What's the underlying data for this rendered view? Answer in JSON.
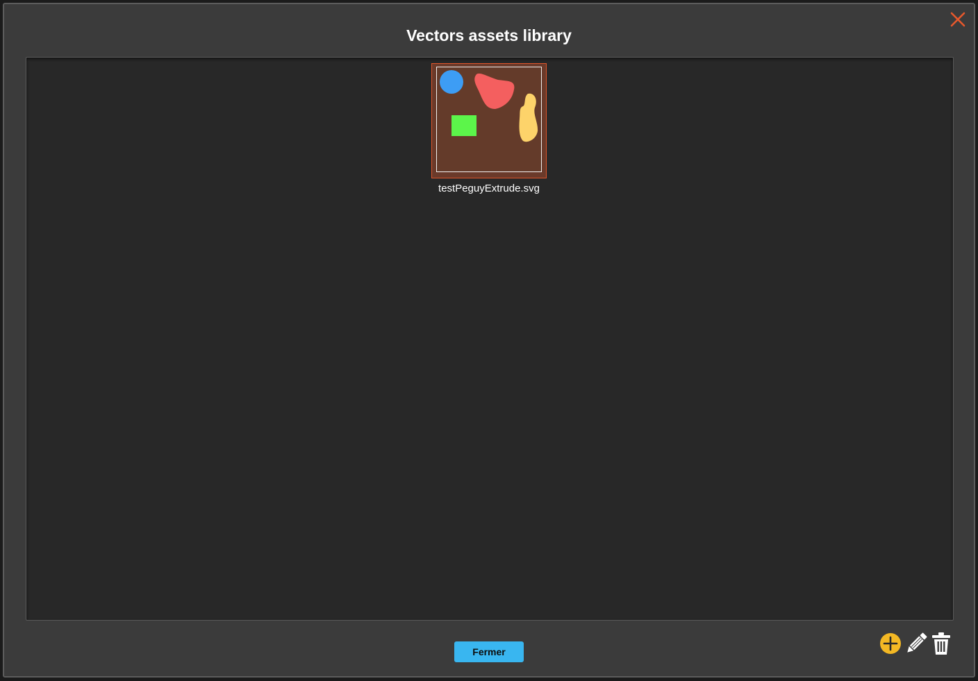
{
  "dialog": {
    "title": "Vectors assets library",
    "close_icon": "close-x-icon"
  },
  "library": {
    "assets": [
      {
        "file_name": "testPeguyExtrude.svg",
        "selected": true,
        "thumbnail_shapes": [
          {
            "shape": "circle",
            "color": "#3d9df5"
          },
          {
            "shape": "blob",
            "color": "#f45f5f"
          },
          {
            "shape": "rectangle",
            "color": "#5cf54a"
          },
          {
            "shape": "blob",
            "color": "#fdd36a"
          }
        ]
      }
    ]
  },
  "footer": {
    "close_label": "Fermer"
  },
  "toolbar": {
    "add_icon": "add-circle-icon",
    "edit_icon": "pencil-icon",
    "delete_icon": "trash-icon"
  },
  "colors": {
    "dialog_background": "#3b3b3b",
    "panel_background": "#282828",
    "accent_orange": "#e0552a",
    "button_blue": "#39b6f0",
    "add_icon_yellow": "#f3b824"
  }
}
